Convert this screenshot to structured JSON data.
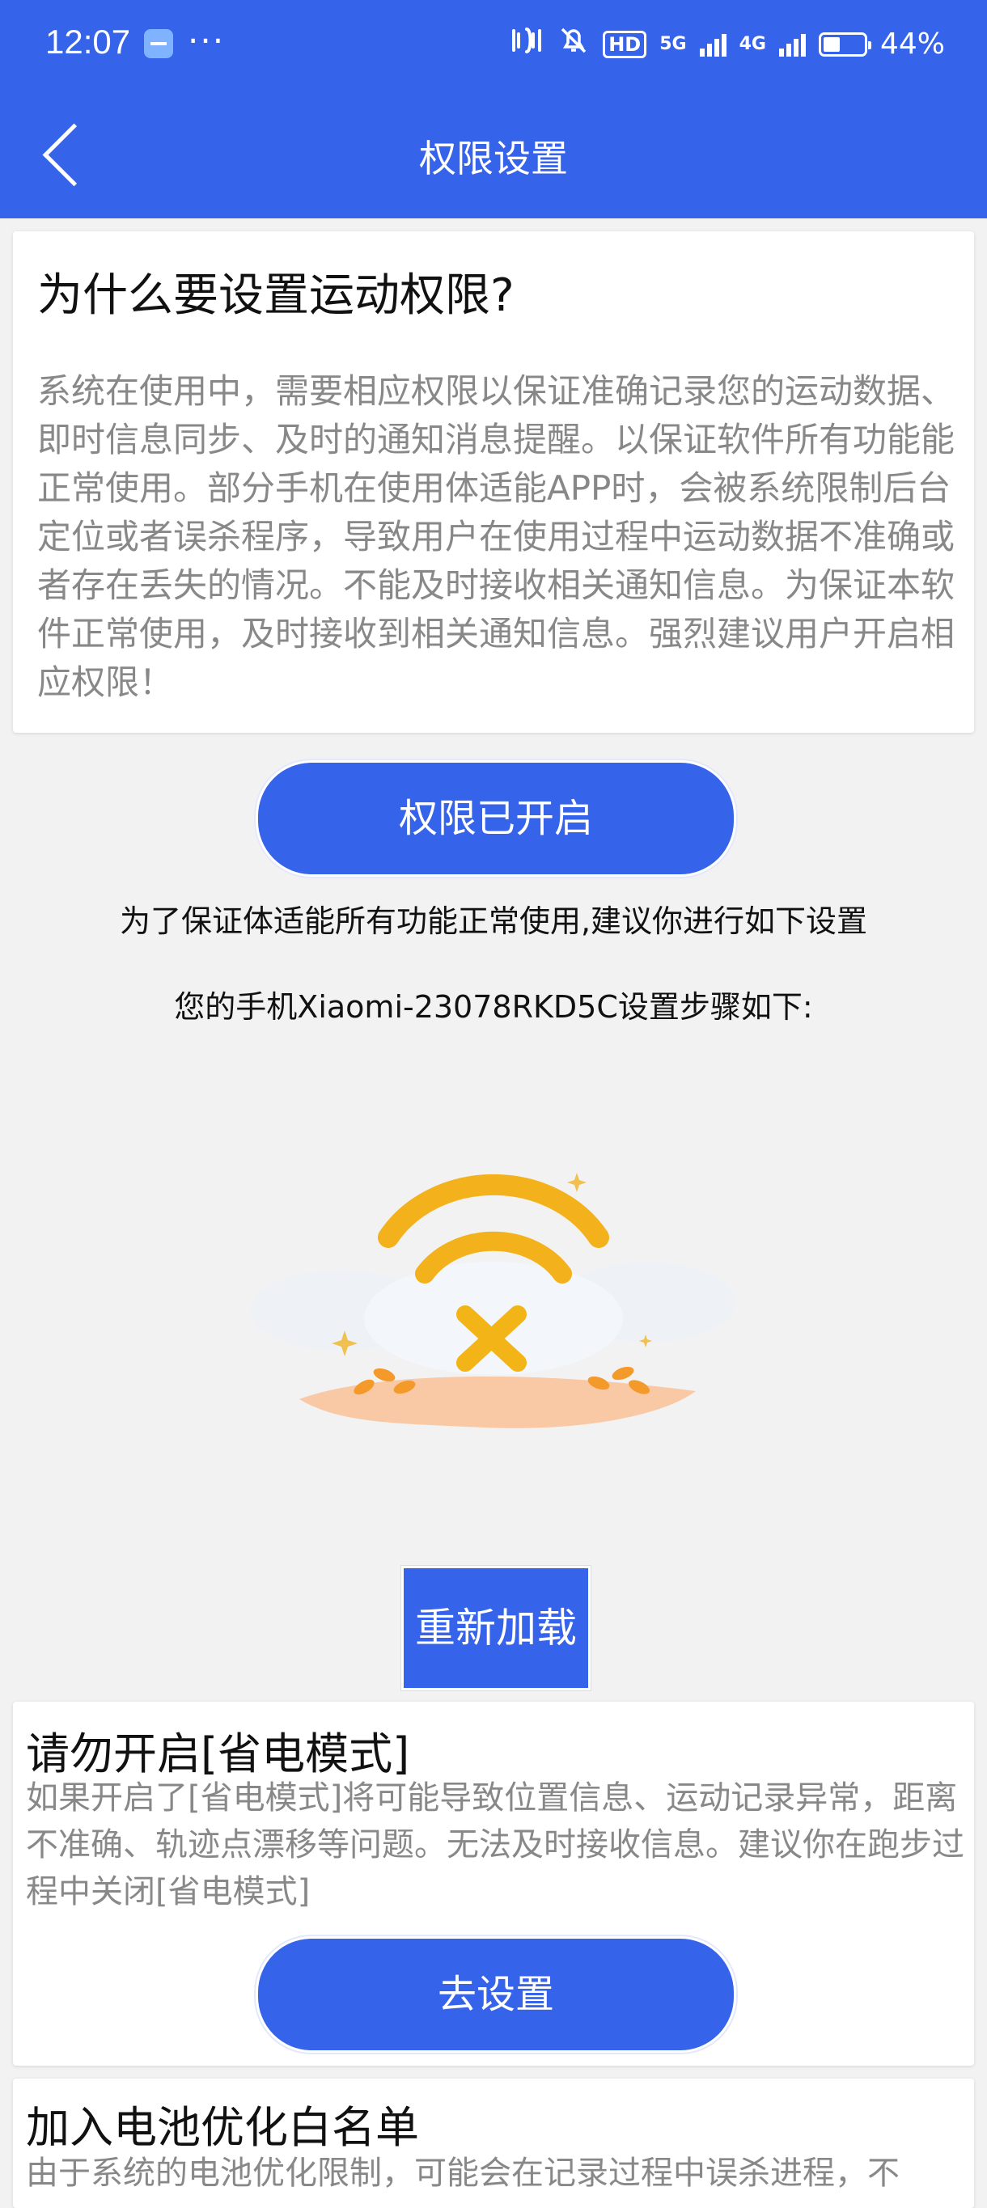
{
  "status_bar": {
    "time": "12:07",
    "dots": "···",
    "hd": "HD",
    "net1": "5G",
    "net2": "4G",
    "battery": "44%"
  },
  "header": {
    "title": "权限设置"
  },
  "intro": {
    "heading": "为什么要设置运动权限?",
    "body": "系统在使用中，需要相应权限以保证准确记录您的运动数据、即时信息同步、及时的通知消息提醒。以保证软件所有功能能正常使用。部分手机在使用体适能APP时，会被系统限制后台定位或者误杀程序，导致用户在使用过程中运动数据不准确或者存在丢失的情况。不能及时接收相关通知信息。为保证本软件正常使用，及时接收到相关通知信息。强烈建议用户开启相应权限！"
  },
  "permission_button": "权限已开启",
  "tip1": "为了保证体适能所有功能正常使用,建议你进行如下设置",
  "tip2": "您的手机Xiaomi-23078RKD5C设置步骤如下:",
  "reload_button": "重新加载",
  "power_save": {
    "heading": "请勿开启[省电模式]",
    "body": "如果开启了[省电模式]将可能导致位置信息、运动记录异常，距离不准确、轨迹点漂移等问题。无法及时接收信息。建议你在跑步过程中关闭[省电模式]",
    "button": "去设置"
  },
  "battery_whitelist": {
    "heading": "加入电池优化白名单",
    "body": "由于系统的电池优化限制，可能会在记录过程中误杀进程，不"
  },
  "colors": {
    "primary": "#3563e9",
    "background": "#f2f2f2"
  },
  "icons": [
    "back-arrow-icon",
    "wifi-disconnected-illustration"
  ]
}
